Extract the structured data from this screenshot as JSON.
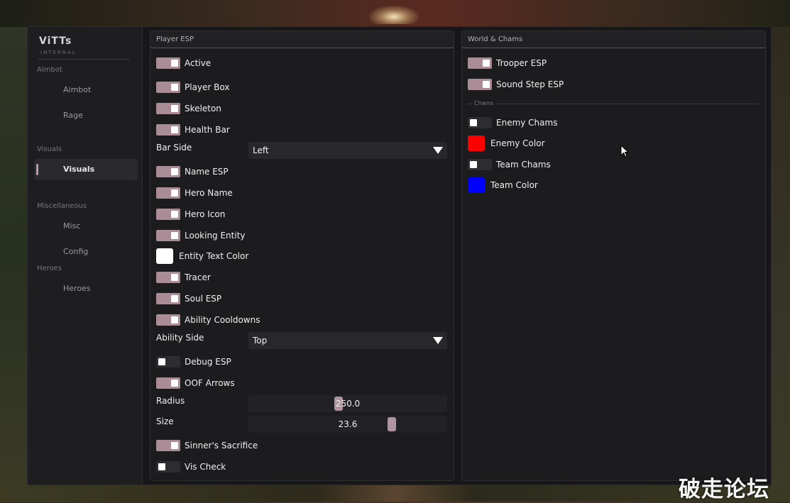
{
  "brand": {
    "title": "ViTTs",
    "subtitle": "INTERNAL"
  },
  "sidebar": {
    "sections": [
      {
        "label": "Aimbot",
        "items": [
          "Aimbot",
          "Rage"
        ]
      },
      {
        "label": "Visuals",
        "items": [
          "Visuals"
        ]
      },
      {
        "label": "Miscellaneous",
        "items": [
          "Misc",
          "Config"
        ]
      },
      {
        "label": "Heroes",
        "items": [
          "Heroes"
        ]
      }
    ],
    "active_item": "Visuals"
  },
  "player_esp": {
    "title": "Player ESP",
    "active": {
      "label": "Active",
      "on": true
    },
    "player_box": {
      "label": "Player Box",
      "on": true
    },
    "skeleton": {
      "label": "Skeleton",
      "on": true
    },
    "health_bar": {
      "label": "Health Bar",
      "on": true
    },
    "bar_side": {
      "label": "Bar Side",
      "value": "Left"
    },
    "name_esp": {
      "label": "Name ESP",
      "on": true
    },
    "hero_name": {
      "label": "Hero Name",
      "on": true
    },
    "hero_icon": {
      "label": "Hero Icon",
      "on": true
    },
    "looking_entity": {
      "label": "Looking Entity",
      "on": true
    },
    "entity_text_color": {
      "label": "Entity Text Color",
      "color": "#ffffff"
    },
    "tracer": {
      "label": "Tracer",
      "on": true
    },
    "soul_esp": {
      "label": "Soul ESP",
      "on": true
    },
    "ability_cooldowns": {
      "label": "Ability Cooldowns",
      "on": true
    },
    "ability_side": {
      "label": "Ability Side",
      "value": "Top"
    },
    "debug_esp": {
      "label": "Debug ESP",
      "on": false
    },
    "oof_arrows": {
      "label": "OOF Arrows",
      "on": true
    },
    "radius": {
      "label": "Radius",
      "value": "250.0",
      "fraction": 0.45
    },
    "size": {
      "label": "Size",
      "value": "23.6",
      "fraction": 0.73
    },
    "sinners_sacrifice": {
      "label": "Sinner's Sacrifice",
      "on": true
    },
    "vis_check": {
      "label": "Vis Check",
      "on": false
    }
  },
  "world_chams": {
    "title": "World & Chams",
    "trooper_esp": {
      "label": "Trooper ESP",
      "on": true
    },
    "sound_step_esp": {
      "label": "Sound Step ESP",
      "on": true
    },
    "chams_separator": "Chams",
    "enemy_chams": {
      "label": "Enemy Chams",
      "on": false
    },
    "enemy_color": {
      "label": "Enemy Color",
      "color": "#ff0000"
    },
    "team_chams": {
      "label": "Team Chams",
      "on": false
    },
    "team_color": {
      "label": "Team Color",
      "color": "#0000ff"
    }
  },
  "watermark": "破走论坛",
  "colors": {
    "accent": "#a98c96",
    "panel": "#1c1c1f",
    "background": "#17171a"
  }
}
